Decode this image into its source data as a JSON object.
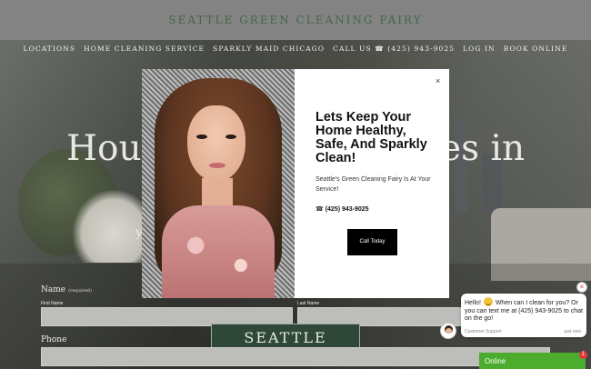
{
  "header": {
    "brand": "SEATTLE GREEN CLEANING FAIRY"
  },
  "nav": {
    "items": [
      {
        "label": "LOCATIONS"
      },
      {
        "label": "HOME CLEANING SERVICE"
      },
      {
        "label": "SPARKLY MAID CHICAGO"
      },
      {
        "label": "CALL US ☎ (425) 943-9025"
      },
      {
        "label": "LOG IN"
      },
      {
        "label": "BOOK ONLINE"
      }
    ]
  },
  "hero": {
    "title_left": "Hou",
    "title_right": "es in",
    "subtitle_left": "y",
    "subtitle_right": "n",
    "sign_text": "SEATTLE"
  },
  "form": {
    "name_label": "Name",
    "name_required": "(required)",
    "first_name_label": "First Name",
    "last_name_label": "Last Name",
    "phone_label": "Phone"
  },
  "modal": {
    "title": "Lets Keep Your Home Healthy, Safe, And Sparkly Clean!",
    "text": "Seattle's Green Cleaning Fairy Is At Your Service!",
    "phone_icon": "☎",
    "phone": "(425) 943-9025",
    "call_button": "Call Today",
    "close": "×"
  },
  "chat": {
    "close": "×",
    "msg_before": "Hello!",
    "msg_after": "When can I clean for you? Or you can text me at (425) 943-9025 to chat on the go!",
    "agent": "Customer Support",
    "time": "just now",
    "status": "Online",
    "badge": "1"
  },
  "colors": {
    "brand": "#46664a",
    "online": "#4cac2e",
    "header_bg": "#838383"
  }
}
